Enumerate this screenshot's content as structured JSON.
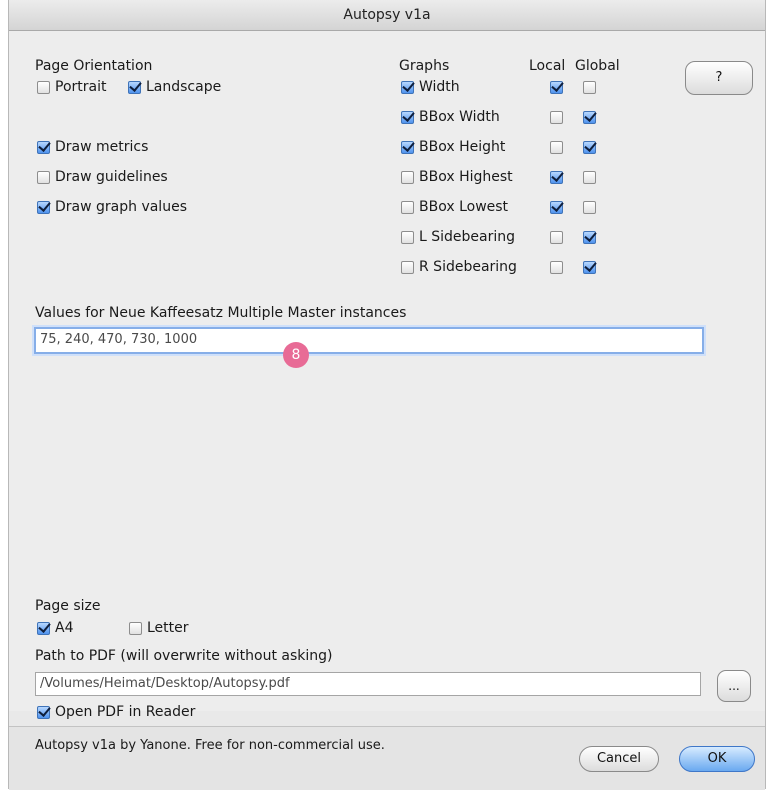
{
  "window": {
    "title": "Autopsy v1a"
  },
  "orientation": {
    "heading": "Page Orientation",
    "portrait": {
      "label": "Portrait",
      "checked": false
    },
    "landscape": {
      "label": "Landscape",
      "checked": true
    }
  },
  "draw_options": [
    {
      "label": "Draw metrics",
      "checked": true
    },
    {
      "label": "Draw guidelines",
      "checked": false
    },
    {
      "label": "Draw graph values",
      "checked": true
    }
  ],
  "graphs": {
    "heading": "Graphs",
    "local_heading": "Local",
    "global_heading": "Global",
    "rows": [
      {
        "label": "Width",
        "checked": true,
        "local": true,
        "global": false
      },
      {
        "label": "BBox Width",
        "checked": true,
        "local": false,
        "global": true
      },
      {
        "label": "BBox Height",
        "checked": true,
        "local": false,
        "global": true
      },
      {
        "label": "BBox Highest",
        "checked": false,
        "local": true,
        "global": false
      },
      {
        "label": "BBox Lowest",
        "checked": false,
        "local": true,
        "global": false
      },
      {
        "label": "L Sidebearing",
        "checked": false,
        "local": false,
        "global": true
      },
      {
        "label": "R Sidebearing",
        "checked": false,
        "local": false,
        "global": true
      }
    ]
  },
  "help_button": {
    "label": "?"
  },
  "values": {
    "label": "Values for Neue Kaffeesatz Multiple Master instances",
    "value": "75, 240, 470, 730, 1000",
    "badge": "8"
  },
  "page_size": {
    "heading": "Page size",
    "a4": {
      "label": "A4",
      "checked": true
    },
    "letter": {
      "label": "Letter",
      "checked": false
    }
  },
  "pdf_path": {
    "label": "Path to PDF (will overwrite without asking)",
    "value": "/Volumes/Heimat/Desktop/Autopsy.pdf",
    "browse_label": "..."
  },
  "open_pdf": {
    "label": "Open PDF in Reader",
    "checked": true
  },
  "footer": {
    "credit": "Autopsy v1a by Yanone. Free for non-commercial use.",
    "cancel_label": "Cancel",
    "ok_label": "OK"
  }
}
